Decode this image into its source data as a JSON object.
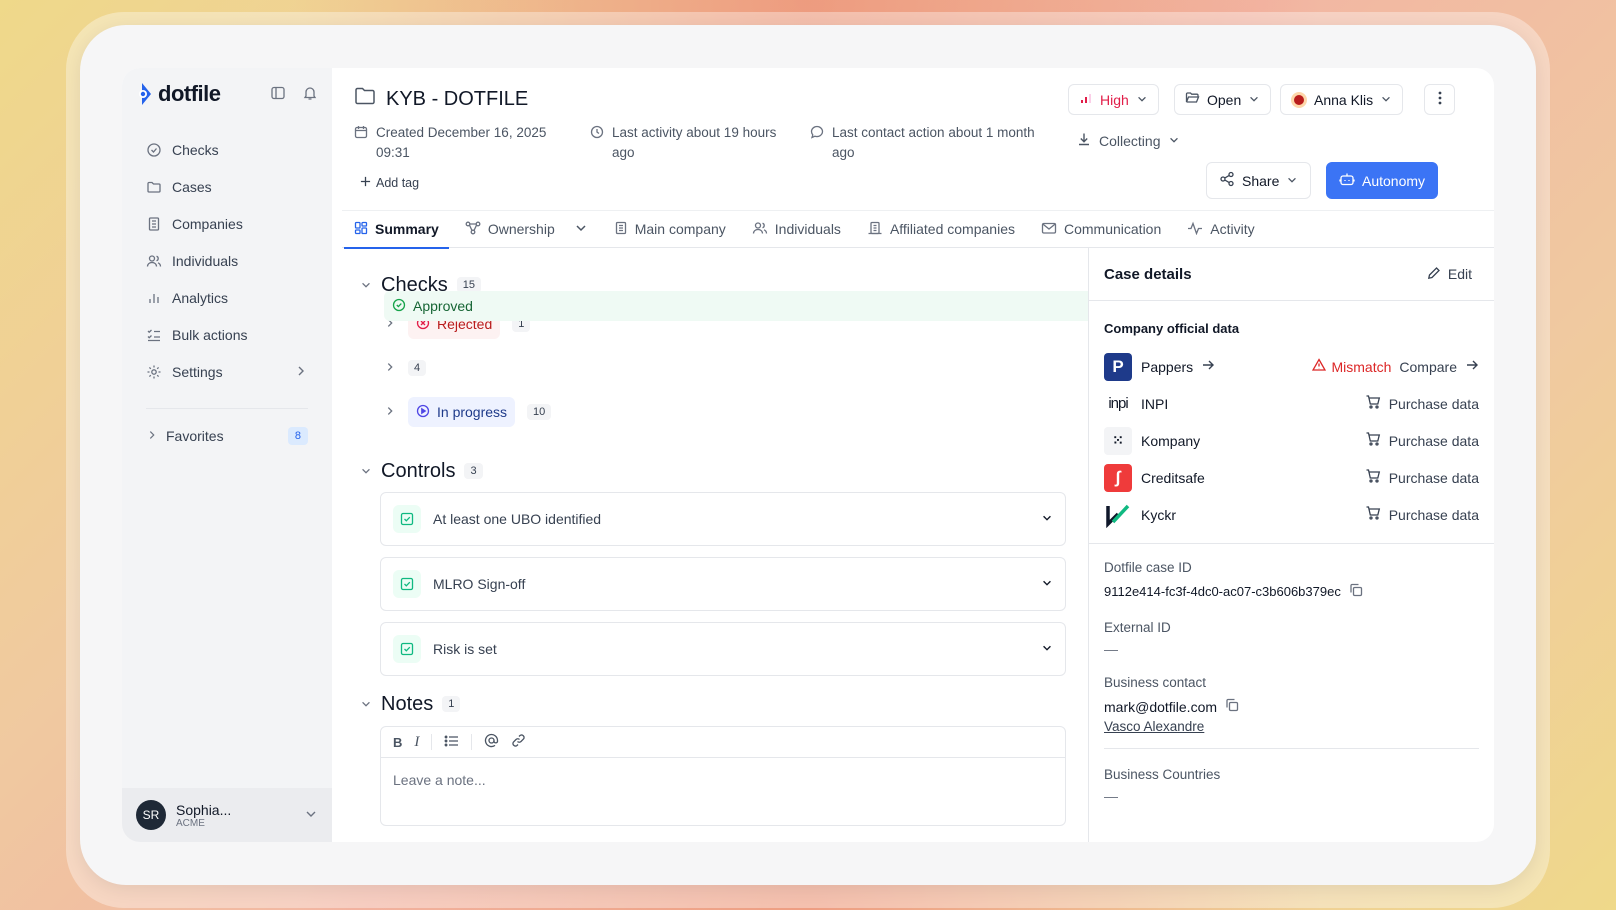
{
  "sidebar": {
    "brand": "dotfile",
    "nav": [
      {
        "label": "Checks",
        "icon": "check-circle-icon"
      },
      {
        "label": "Cases",
        "icon": "folder-icon"
      },
      {
        "label": "Companies",
        "icon": "building-icon"
      },
      {
        "label": "Individuals",
        "icon": "users-icon"
      },
      {
        "label": "Analytics",
        "icon": "bar-chart-icon"
      },
      {
        "label": "Bulk actions",
        "icon": "list-check-icon"
      },
      {
        "label": "Settings",
        "icon": "gear-icon"
      }
    ],
    "favorites": {
      "label": "Favorites",
      "count": "8"
    },
    "user": {
      "initials": "SR",
      "name": "Sophia...",
      "org": "ACME"
    }
  },
  "header": {
    "title": "KYB - DOTFILE",
    "created": "Created December 16, 2025 09:31",
    "last_activity": "Last activity about 19 hours ago",
    "last_contact": "Last contact action about 1 month ago",
    "add_tag": "Add tag",
    "risk": "High",
    "status": "Open",
    "assignee": "Anna Klis",
    "stage": "Collecting",
    "share": "Share",
    "autonomy": "Autonomy"
  },
  "tabs": [
    "Summary",
    "Ownership",
    "Main company",
    "Individuals",
    "Affiliated companies",
    "Communication",
    "Activity"
  ],
  "checks": {
    "title": "Checks",
    "count": "15",
    "groups": [
      {
        "label": "Rejected",
        "count": "1"
      },
      {
        "label": "Approved",
        "count": "4"
      },
      {
        "label": "In progress",
        "count": "10"
      }
    ]
  },
  "controls": {
    "title": "Controls",
    "count": "3",
    "items": [
      "At least one UBO identified",
      "MLRO Sign-off",
      "Risk is set"
    ]
  },
  "notes": {
    "title": "Notes",
    "count": "1",
    "placeholder": "Leave a note..."
  },
  "panel": {
    "title": "Case details",
    "edit": "Edit",
    "official_title": "Company official data",
    "providers": [
      {
        "name": "Pappers",
        "mismatch": "Mismatch",
        "action": "Compare"
      },
      {
        "name": "INPI",
        "action": "Purchase data"
      },
      {
        "name": "Kompany",
        "action": "Purchase data"
      },
      {
        "name": "Creditsafe",
        "action": "Purchase data"
      },
      {
        "name": "Kyckr",
        "action": "Purchase data"
      }
    ],
    "case_id_label": "Dotfile case ID",
    "case_id": "9112e414-fc3f-4dc0-ac07-c3b606b379ec",
    "external_id_label": "External ID",
    "external_id": "—",
    "business_contact_label": "Business contact",
    "business_contact_email": "mark@dotfile.com",
    "business_contact_name": "Vasco Alexandre",
    "business_countries_label": "Business Countries",
    "business_countries": "—"
  },
  "colors": {
    "accent": "#3b74f5",
    "danger": "#dc2626",
    "success": "#10b981"
  }
}
